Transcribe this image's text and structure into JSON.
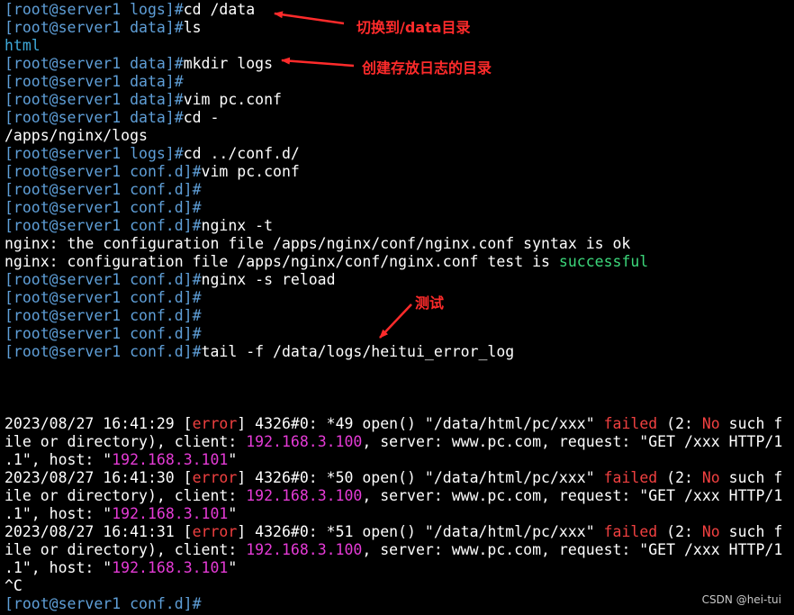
{
  "colors": {
    "background": "#000000",
    "prompt": "#5f9fd8",
    "command": "#ffffff",
    "directory": "#3ea8d8",
    "success": "#3cd77b",
    "error": "#f04040",
    "ip_address": "#e53bd6",
    "annotation": "#ff2b2b"
  },
  "terminal": {
    "lines": [
      [
        {
          "t": "[root@server1 logs]#",
          "c": "prompt"
        },
        {
          "t": "cd /data",
          "c": "cmd"
        }
      ],
      [
        {
          "t": "[root@server1 data]#",
          "c": "prompt"
        },
        {
          "t": "ls",
          "c": "cmd"
        }
      ],
      [
        {
          "t": "html",
          "c": "dir"
        }
      ],
      [
        {
          "t": "[root@server1 data]#",
          "c": "prompt"
        },
        {
          "t": "mkdir logs",
          "c": "cmd"
        }
      ],
      [
        {
          "t": "[root@server1 data]#",
          "c": "prompt"
        }
      ],
      [
        {
          "t": "[root@server1 data]#",
          "c": "prompt"
        },
        {
          "t": "vim pc.conf",
          "c": "cmd"
        }
      ],
      [
        {
          "t": "[root@server1 data]#",
          "c": "prompt"
        },
        {
          "t": "cd -",
          "c": "cmd"
        }
      ],
      [
        {
          "t": "/apps/nginx/logs",
          "c": "plain"
        }
      ],
      [
        {
          "t": "[root@server1 logs]#",
          "c": "prompt"
        },
        {
          "t": "cd ../conf.d/",
          "c": "cmd"
        }
      ],
      [
        {
          "t": "[root@server1 conf.d]#",
          "c": "prompt"
        },
        {
          "t": "vim pc.conf",
          "c": "cmd"
        }
      ],
      [
        {
          "t": "[root@server1 conf.d]#",
          "c": "prompt"
        }
      ],
      [
        {
          "t": "[root@server1 conf.d]#",
          "c": "prompt"
        }
      ],
      [
        {
          "t": "[root@server1 conf.d]#",
          "c": "prompt"
        },
        {
          "t": "nginx -t",
          "c": "cmd"
        }
      ],
      [
        {
          "t": "nginx: the configuration file /apps/nginx/conf/nginx.conf syntax is ok",
          "c": "plain"
        }
      ],
      [
        {
          "t": "nginx: configuration file /apps/nginx/conf/nginx.conf test is ",
          "c": "plain"
        },
        {
          "t": "successful",
          "c": "green"
        }
      ],
      [
        {
          "t": "[root@server1 conf.d]#",
          "c": "prompt"
        },
        {
          "t": "nginx -s reload",
          "c": "cmd"
        }
      ],
      [
        {
          "t": "[root@server1 conf.d]#",
          "c": "prompt"
        }
      ],
      [
        {
          "t": "[root@server1 conf.d]#",
          "c": "prompt"
        }
      ],
      [
        {
          "t": "[root@server1 conf.d]#",
          "c": "prompt"
        }
      ],
      [
        {
          "t": "[root@server1 conf.d]#",
          "c": "prompt"
        },
        {
          "t": "tail -f /data/logs/heitui_error_log",
          "c": "cmd"
        }
      ],
      [],
      [],
      [],
      [
        {
          "t": "2023/08/27 16:41:29 [",
          "c": "plain"
        },
        {
          "t": "error",
          "c": "red"
        },
        {
          "t": "] 4326#0: *49 open() \"/data/html/pc/xxx\" ",
          "c": "plain"
        },
        {
          "t": "failed",
          "c": "red"
        },
        {
          "t": " (2: ",
          "c": "plain"
        },
        {
          "t": "No",
          "c": "red"
        },
        {
          "t": " such f",
          "c": "plain"
        }
      ],
      [
        {
          "t": "ile or directory), client: ",
          "c": "plain"
        },
        {
          "t": "192.168.3.100",
          "c": "ip"
        },
        {
          "t": ", server: www.pc.com, request: \"GET /xxx HTTP/1",
          "c": "plain"
        }
      ],
      [
        {
          "t": ".1\", host: \"",
          "c": "plain"
        },
        {
          "t": "192.168.3.101",
          "c": "ip"
        },
        {
          "t": "\"",
          "c": "plain"
        }
      ],
      [
        {
          "t": "2023/08/27 16:41:30 [",
          "c": "plain"
        },
        {
          "t": "error",
          "c": "red"
        },
        {
          "t": "] 4326#0: *50 open() \"/data/html/pc/xxx\" ",
          "c": "plain"
        },
        {
          "t": "failed",
          "c": "red"
        },
        {
          "t": " (2: ",
          "c": "plain"
        },
        {
          "t": "No",
          "c": "red"
        },
        {
          "t": " such f",
          "c": "plain"
        }
      ],
      [
        {
          "t": "ile or directory), client: ",
          "c": "plain"
        },
        {
          "t": "192.168.3.100",
          "c": "ip"
        },
        {
          "t": ", server: www.pc.com, request: \"GET /xxx HTTP/1",
          "c": "plain"
        }
      ],
      [
        {
          "t": ".1\", host: \"",
          "c": "plain"
        },
        {
          "t": "192.168.3.101",
          "c": "ip"
        },
        {
          "t": "\"",
          "c": "plain"
        }
      ],
      [
        {
          "t": "2023/08/27 16:41:31 [",
          "c": "plain"
        },
        {
          "t": "error",
          "c": "red"
        },
        {
          "t": "] 4326#0: *51 open() \"/data/html/pc/xxx\" ",
          "c": "plain"
        },
        {
          "t": "failed",
          "c": "red"
        },
        {
          "t": " (2: ",
          "c": "plain"
        },
        {
          "t": "No",
          "c": "red"
        },
        {
          "t": " such f",
          "c": "plain"
        }
      ],
      [
        {
          "t": "ile or directory), client: ",
          "c": "plain"
        },
        {
          "t": "192.168.3.100",
          "c": "ip"
        },
        {
          "t": ", server: www.pc.com, request: \"GET /xxx HTTP/1",
          "c": "plain"
        }
      ],
      [
        {
          "t": ".1\", host: \"",
          "c": "plain"
        },
        {
          "t": "192.168.3.101",
          "c": "ip"
        },
        {
          "t": "\"",
          "c": "plain"
        }
      ],
      [
        {
          "t": "^C",
          "c": "plain"
        }
      ],
      [
        {
          "t": "[root@server1 conf.d]#",
          "c": "prompt"
        }
      ]
    ]
  },
  "annotations": {
    "switch_to_data": "切换到/data目录",
    "create_log_dir": "创建存放日志的目录",
    "test": "测试"
  },
  "watermark": "CSDN @hei-tui"
}
